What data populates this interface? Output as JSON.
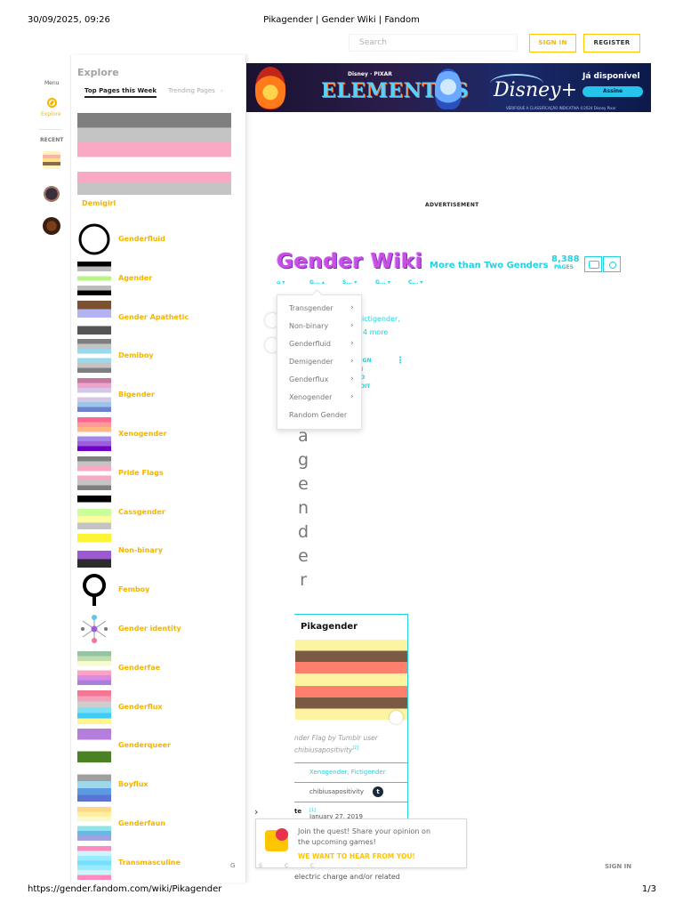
{
  "print": {
    "date": "30/09/2025, 09:26",
    "title": "Pikagender | Gender Wiki | Fandom",
    "url": "https://gender.fandom.com/wiki/Pikagender",
    "page": "1/3"
  },
  "topnav": {
    "search_placeholder": "Search",
    "signin": "SIGN IN",
    "register": "REGISTER"
  },
  "rail": {
    "menu": "Menu",
    "explore": "Explore",
    "recent": "RECENT"
  },
  "explore_panel": {
    "title": "Explore",
    "tabs": [
      "Top Pages this Week",
      "Trending Pages"
    ],
    "top_item": "Demigirl",
    "items": [
      {
        "label": "Genderfluid",
        "icon": "ring-icon"
      },
      {
        "label": "Agender",
        "colors": [
          "#000000",
          "#bcbcbc",
          "#ffffff",
          "#b8f483",
          "#ffffff",
          "#bcbcbc",
          "#000000"
        ]
      },
      {
        "label": "Gender Apathetic",
        "colors": [
          "#7a5232",
          "#b3b3f4",
          "#ffffff",
          "#555555"
        ]
      },
      {
        "label": "Demiboy",
        "colors": [
          "#7f7f7f",
          "#c4c4c4",
          "#9ad9eb",
          "#ffffff",
          "#9ad9eb",
          "#c4c4c4",
          "#7f7f7f"
        ]
      },
      {
        "label": "Bigender",
        "colors": [
          "#c479a2",
          "#eda5cd",
          "#d6c7e8",
          "#ffffff",
          "#d6c7e8",
          "#9ac7e8",
          "#6d82d1"
        ]
      },
      {
        "label": "Xenogender",
        "colors": [
          "#ff6692",
          "#ff9a98",
          "#ffb883",
          "#fbfbfb",
          "#a287e8",
          "#9b5dda",
          "#6f00c4"
        ]
      },
      {
        "label": "Pride Flags",
        "colors": [
          "#7f7f7f",
          "#c4c4c4",
          "#f9a9c3",
          "#ffffff",
          "#f9a9c3",
          "#c4c4c4",
          "#7f7f7f"
        ]
      },
      {
        "label": "Cassgender",
        "colors": [
          "#000000",
          "#fefefe",
          "#c9ff98",
          "#fdfda0",
          "#c4c4c4"
        ]
      },
      {
        "label": "Non-binary",
        "colors": [
          "#fcf434",
          "#ffffff",
          "#9c59d1",
          "#2c2c2c"
        ]
      },
      {
        "label": "Femboy",
        "icon": "venus-icon"
      },
      {
        "label": "Gender identity",
        "icon": "molecule-icon"
      },
      {
        "label": "Genderfae",
        "colors": [
          "#97c3a5",
          "#c3deae",
          "#f9facd",
          "#ffffff",
          "#fca2c4",
          "#db8ae4",
          "#a97edd"
        ]
      },
      {
        "label": "Genderflux",
        "colors": [
          "#f47694",
          "#f2a2b9",
          "#cecece",
          "#7ce0f7",
          "#3ecdf9",
          "#fff48d"
        ]
      },
      {
        "label": "Genderqueer",
        "colors": [
          "#b57edc",
          "#ffffff",
          "#4a8123"
        ]
      },
      {
        "label": "Boyflux",
        "colors": [
          "#ffffff",
          "#9f9f9f",
          "#9dd7ea",
          "#5c9ae3",
          "#5c74d1"
        ]
      },
      {
        "label": "Genderfaun",
        "colors": [
          "#fcd689",
          "#fff09b",
          "#faf9cd",
          "#ffffff",
          "#8ee5e7",
          "#6cb6e3",
          "#a5a0e0"
        ]
      },
      {
        "label": "Transmasculine",
        "colors": [
          "#ff8abd",
          "#cdf5fe",
          "#9aebff",
          "#74dfff",
          "#9aebff",
          "#cdf5fe",
          "#ff8abd"
        ]
      }
    ],
    "footer_letter": "G"
  },
  "ad": {
    "brand_line": "Disney · PIXAR",
    "movie": "ELEMENTOS",
    "service": "Disney+",
    "cta_text": "Já disponível",
    "cta_button": "Assine",
    "fine_print": "VERIFIQUE A CLASSIFICAÇÃO INDICATIVA ©2024 Disney Pixar",
    "label": "ADVERTISEMENT"
  },
  "wiki": {
    "name": "Gender Wiki",
    "tagline": "More than Two Genders",
    "pages_count": "8,388",
    "pages_label": "PAGES",
    "nav": [
      "G...",
      "S...",
      "G...",
      "C..."
    ]
  },
  "dropdown": {
    "items": [
      "Transgender",
      "Non-binary",
      "Genderfluid",
      "Demigender",
      "Genderflux",
      "Xenogender",
      "Random Gender"
    ],
    "has_submenu": [
      true,
      true,
      true,
      true,
      true,
      true,
      false
    ]
  },
  "article": {
    "cat_frag": "ictigender,",
    "more_frag": "4 more",
    "edit_lines": [
      "SIGN",
      "IN",
      "TO",
      "EDIT"
    ],
    "vertical_letters": [
      "a",
      "g",
      "e",
      "n",
      "d",
      "e",
      "r"
    ],
    "bottom_text": "electric charge and/or related",
    "bottom_tiny": [
      "S",
      "C",
      "C"
    ]
  },
  "infobox": {
    "title": "Pikagender",
    "caption_line1": "nder Flag by Tumblr user",
    "caption_line2": "chibiusapositivity",
    "caption_ref": "[1]",
    "row_related": "Xenogender, Fictigender",
    "row_creator": "chibiusapositivity",
    "row_date_label": "te",
    "row_date": "January 27, 2019",
    "row_date_ref": "[1]"
  },
  "quest": {
    "line1": "Join the quest! Share your opinion on",
    "line2": "the upcoming games!",
    "cta": "WE WANT TO HEAR FROM YOU!"
  },
  "footer": {
    "signin": "SIGN IN"
  },
  "colors": {
    "accent_yellow": "#f4b400",
    "wiki_cyan": "#1fd4e0",
    "wiki_purple": "#c94fe0"
  }
}
